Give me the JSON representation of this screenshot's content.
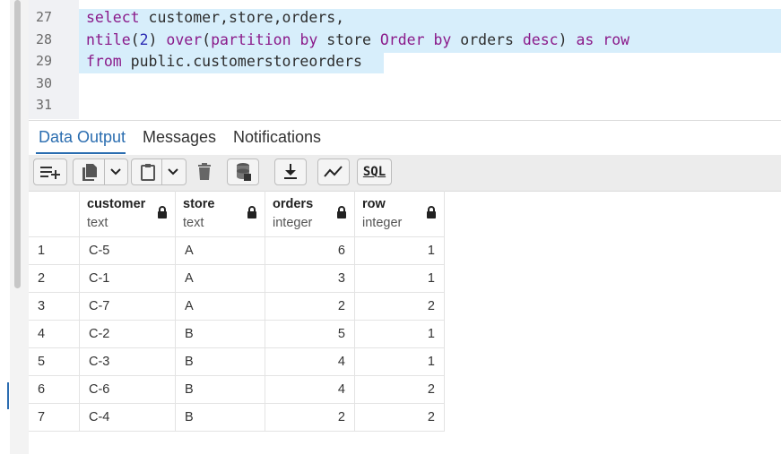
{
  "editor": {
    "line_numbers": [
      "27",
      "28",
      "29",
      "30",
      "31"
    ],
    "lines": [
      {
        "kw1": "select",
        "rest": " customer,store,orders,"
      },
      {
        "fn": "ntile",
        "p1": "(",
        "num": "2",
        "p2": ") ",
        "kw2": "over",
        "p3": "(",
        "kw3": "partition by",
        "p4": " store ",
        "kw4": "Order by",
        "p5": " orders ",
        "kw5": "desc",
        "p6": ") ",
        "kw6": "as",
        "p7": " ",
        "kw7": "row"
      },
      {
        "kw1": "from",
        "rest": " public.customerstoreorders"
      }
    ]
  },
  "tabs": [
    {
      "label": "Data Output",
      "active": true
    },
    {
      "label": "Messages",
      "active": false
    },
    {
      "label": "Notifications",
      "active": false
    }
  ],
  "toolbar": {
    "icons": [
      "add-row-icon",
      "copy-icon",
      "chevron-down-icon",
      "paste-icon",
      "chevron-down-icon",
      "delete-icon",
      "save-data-icon",
      "download-icon",
      "graph-visualiser-icon",
      "sql-icon"
    ],
    "sql_label": "SQL"
  },
  "grid": {
    "columns": [
      {
        "name": "customer",
        "type": "text"
      },
      {
        "name": "store",
        "type": "text"
      },
      {
        "name": "orders",
        "type": "integer"
      },
      {
        "name": "row",
        "type": "integer"
      }
    ],
    "rows": [
      {
        "n": "1",
        "customer": "C-5",
        "store": "A",
        "orders": "6",
        "row": "1"
      },
      {
        "n": "2",
        "customer": "C-1",
        "store": "A",
        "orders": "3",
        "row": "1"
      },
      {
        "n": "3",
        "customer": "C-7",
        "store": "A",
        "orders": "2",
        "row": "2"
      },
      {
        "n": "4",
        "customer": "C-2",
        "store": "B",
        "orders": "5",
        "row": "1"
      },
      {
        "n": "5",
        "customer": "C-3",
        "store": "B",
        "orders": "4",
        "row": "1"
      },
      {
        "n": "6",
        "customer": "C-6",
        "store": "B",
        "orders": "4",
        "row": "2"
      },
      {
        "n": "7",
        "customer": "C-4",
        "store": "B",
        "orders": "2",
        "row": "2"
      }
    ]
  }
}
